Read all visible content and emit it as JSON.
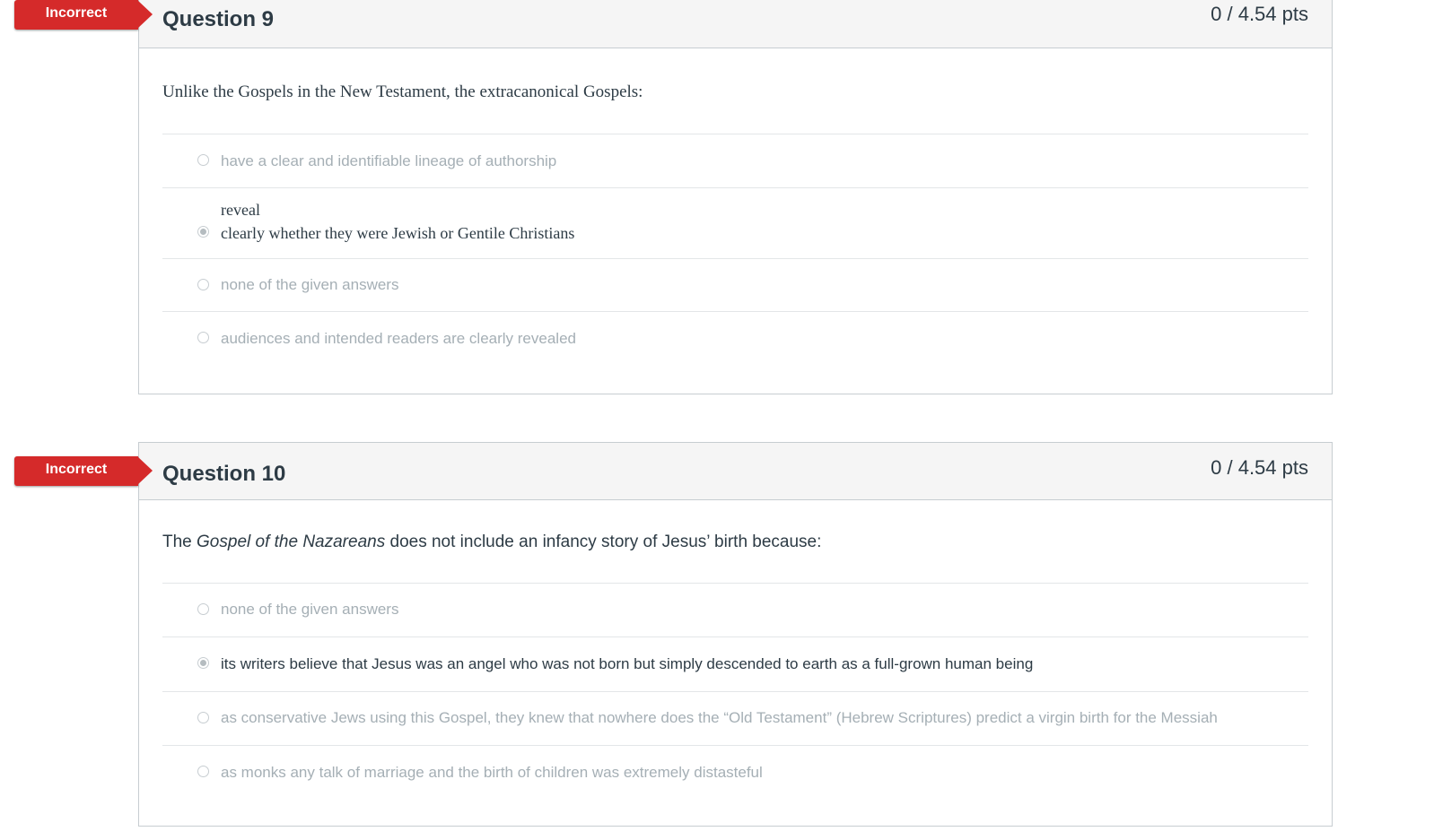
{
  "questions": [
    {
      "badge": "Incorrect",
      "title": "Question 9",
      "points": "0 / 4.54 pts",
      "text": "Unlike the Gospels in the New Testament, the extracanonical Gospels:",
      "answers": [
        {
          "label": "have a clear and identifiable lineage of authorship",
          "selected": false
        },
        {
          "label_line1": "reveal",
          "label_line2": "clearly whether they were Jewish or Gentile Christians",
          "selected": true
        },
        {
          "label": "none of the given answers",
          "selected": false
        },
        {
          "label": "audiences and intended readers are clearly revealed",
          "selected": false
        }
      ]
    },
    {
      "badge": "Incorrect",
      "title": "Question 10",
      "points": "0 / 4.54 pts",
      "text_before": "The ",
      "text_italic": "Gospel of the Nazareans",
      "text_after": " does not include an infancy story of Jesus’ birth because:",
      "answers": [
        {
          "label": "none of the given answers",
          "selected": false
        },
        {
          "label": "its writers believe that Jesus was an angel who was not born but simply descended to earth as a full-grown human being",
          "selected": true
        },
        {
          "label": "as conservative Jews using this Gospel, they knew that nowhere does the “Old Testament” (Hebrew Scriptures) predict a virgin birth for the Messiah",
          "selected": false
        },
        {
          "label": "as monks any talk of marriage and the birth of children was extremely distasteful",
          "selected": false
        }
      ]
    }
  ],
  "colors": {
    "badge": "#d52a2a",
    "header_bg": "#f5f5f5",
    "border": "#c7cdd1",
    "text": "#2d3b45",
    "muted": "#a5afb5"
  }
}
